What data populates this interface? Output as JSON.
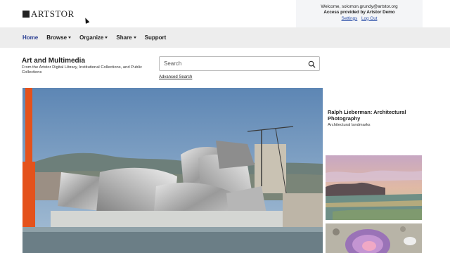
{
  "brand": {
    "name": "ARTSTOR"
  },
  "user": {
    "welcome": "Welcome, solomon.grundy@artstor.org",
    "access": "Access provided by Artstor Demo",
    "settings_label": "Settings",
    "logout_label": "Log Out"
  },
  "nav": {
    "home": "Home",
    "browse": "Browse",
    "organize": "Organize",
    "share": "Share",
    "support": "Support"
  },
  "collection": {
    "title": "Art and Multimedia",
    "subtitle": "From the Artstor Digital Library, Institutional Collections, and Public Collections"
  },
  "search": {
    "placeholder": "Search",
    "advanced_label": "Advanced Search"
  },
  "featured": {
    "title": "Ralph Lieberman: Architectural Photography",
    "subtitle": "Architectural landmarks"
  },
  "colors": {
    "nav_active": "#2b3f93",
    "navbar_bg": "#ededed",
    "link": "#2b4fa8"
  }
}
